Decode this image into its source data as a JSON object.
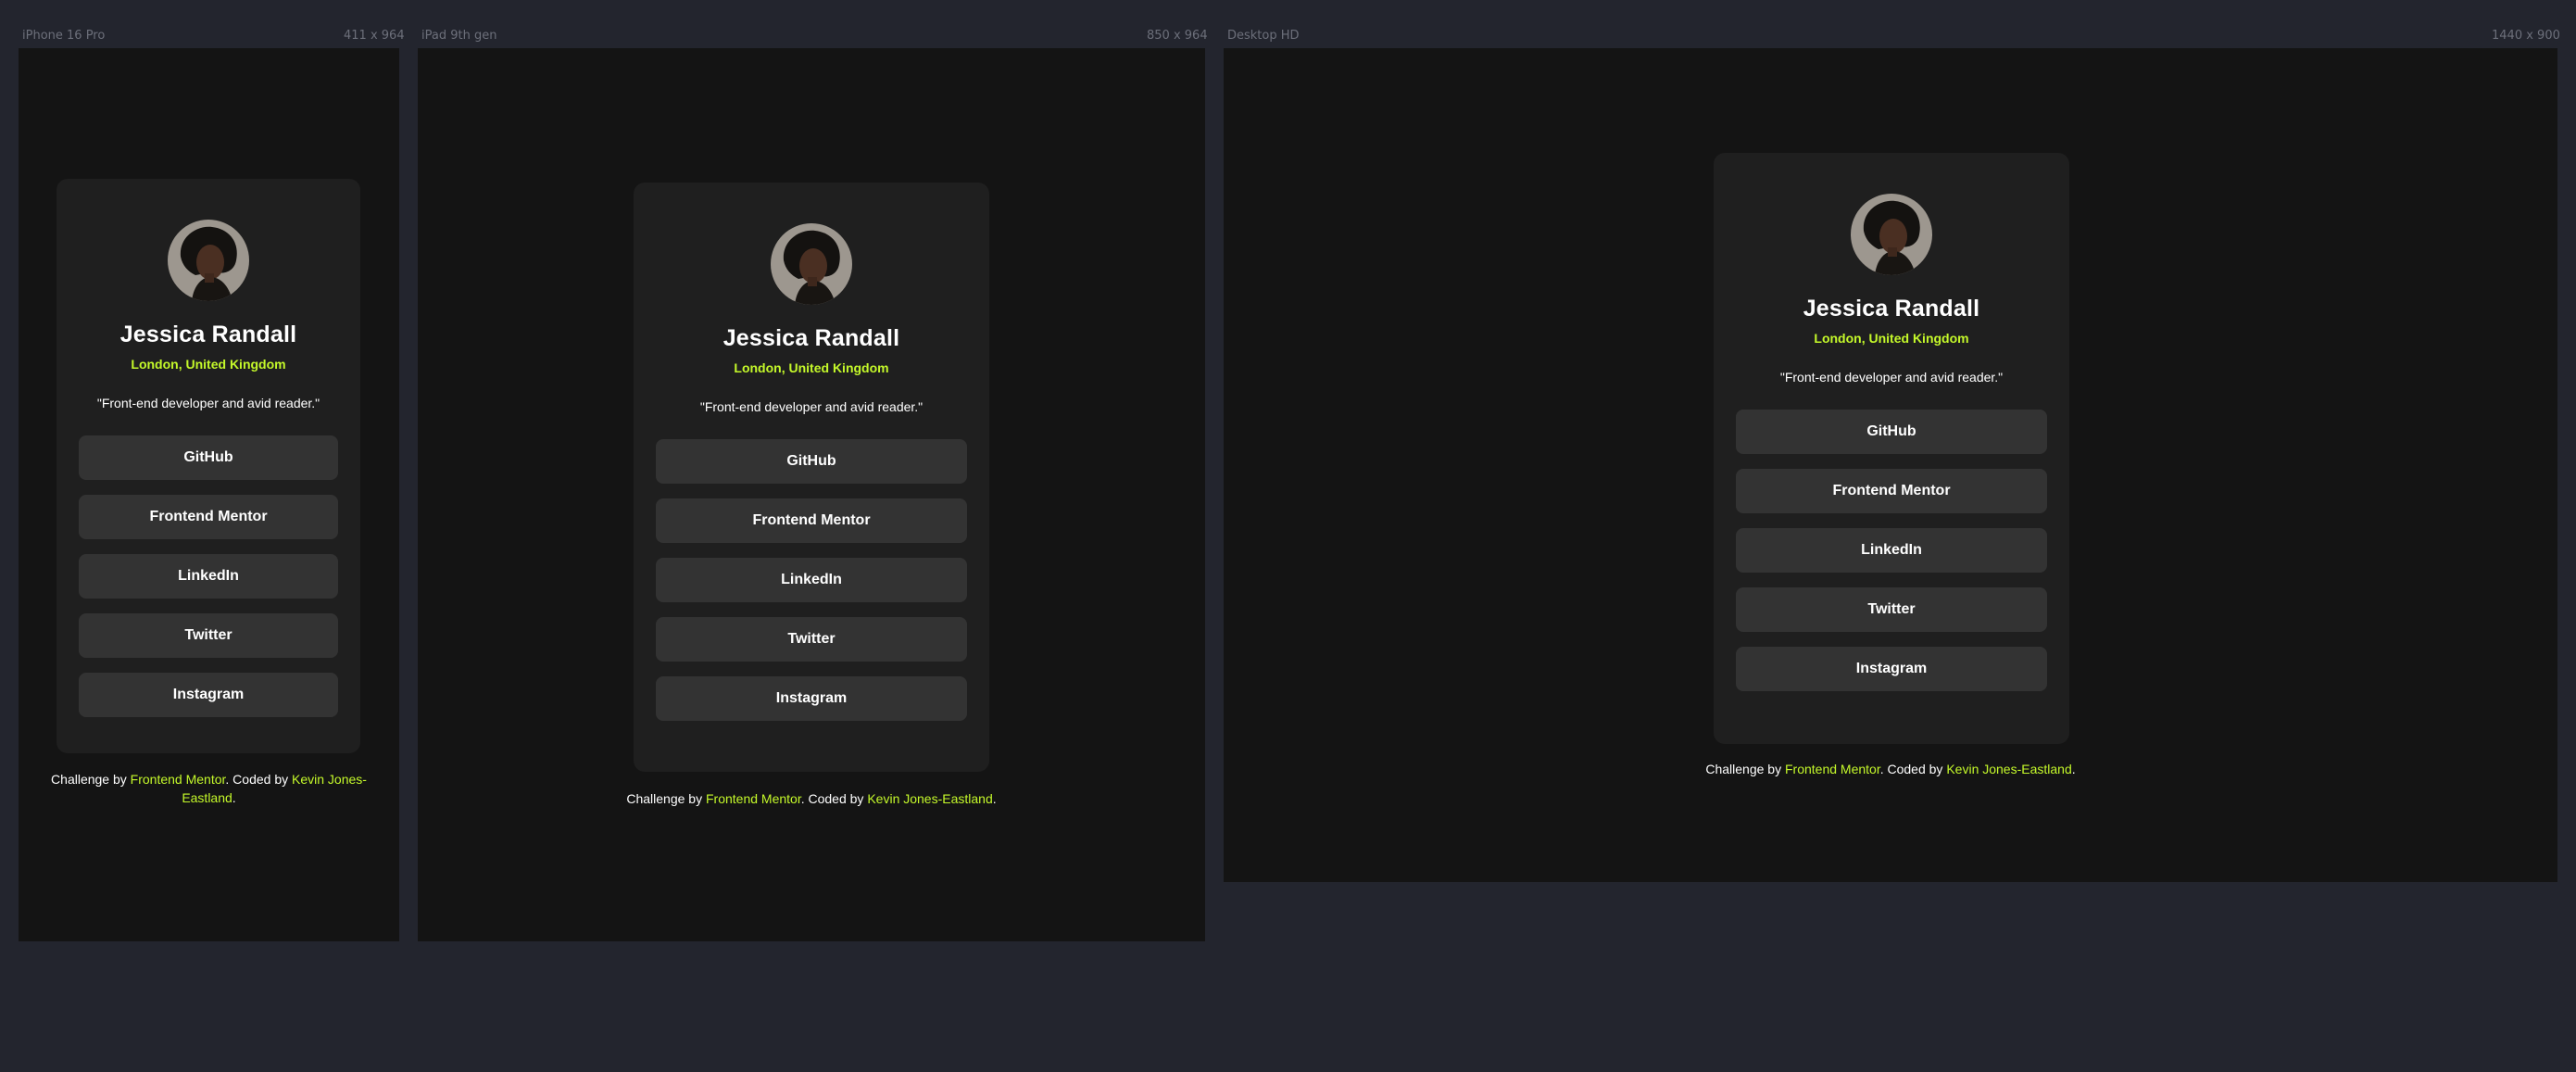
{
  "frames": [
    {
      "device": "iPhone 16 Pro",
      "size": "411 x 964"
    },
    {
      "device": "iPad 9th gen",
      "size": "850 x 964"
    },
    {
      "device": "Desktop HD",
      "size": "1440 x 900"
    }
  ],
  "profile": {
    "name": "Jessica Randall",
    "location": "London, United Kingdom",
    "bio": "\"Front-end developer and avid reader.\"",
    "links": [
      "GitHub",
      "Frontend Mentor",
      "LinkedIn",
      "Twitter",
      "Instagram"
    ]
  },
  "attribution": {
    "prefix": "Challenge by ",
    "challenge_link": "Frontend Mentor",
    "middle": ". Coded by ",
    "coder_link": "Kevin Jones-Eastland",
    "suffix": "."
  },
  "colors": {
    "page_bg": "#23252e",
    "frame_bg": "#141414",
    "card_bg": "#1f1f1f",
    "button_bg": "#333333",
    "accent": "#c4f82a",
    "text": "#ffffff"
  },
  "icons": {
    "avatar": "profile-photo"
  }
}
